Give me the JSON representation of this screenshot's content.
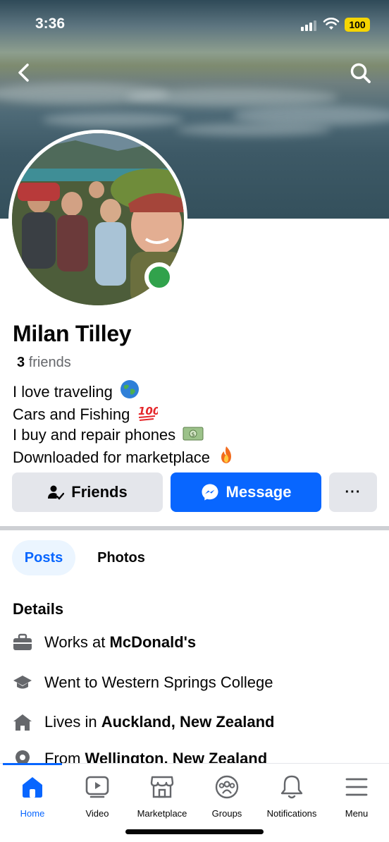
{
  "status_bar": {
    "time": "3:36",
    "battery": "100"
  },
  "profile": {
    "name": "Milan Tilley",
    "friends_count": "3",
    "friends_label": "friends",
    "bio": [
      {
        "text": "I love traveling",
        "emoji": "globe-emoji"
      },
      {
        "text": "Cars and Fishing",
        "emoji": "hundred-points-emoji"
      },
      {
        "text": "I buy and repair phones",
        "emoji": "money-emoji"
      },
      {
        "text": "Downloaded for marketplace",
        "emoji": "fire-emoji"
      }
    ]
  },
  "actions": {
    "friends_label": "Friends",
    "message_label": "Message",
    "more_label": "···"
  },
  "tabs": [
    {
      "label": "Posts",
      "active": true
    },
    {
      "label": "Photos",
      "active": false
    }
  ],
  "details": {
    "title": "Details",
    "work_prefix": "Works at ",
    "work_place": "McDonald's",
    "education": "Went to Western Springs College",
    "lives_prefix": "Lives in ",
    "lives_place": "Auckland, New Zealand",
    "from_prefix": "From ",
    "from_place": "Wellington, New Zealand"
  },
  "nav": [
    {
      "label": "Home",
      "icon": "home-icon",
      "active": true
    },
    {
      "label": "Video",
      "icon": "video-icon",
      "active": false
    },
    {
      "label": "Marketplace",
      "icon": "marketplace-icon",
      "active": false
    },
    {
      "label": "Groups",
      "icon": "groups-icon",
      "active": false
    },
    {
      "label": "Notifications",
      "icon": "bell-icon",
      "active": false
    },
    {
      "label": "Menu",
      "icon": "menu-icon",
      "active": false
    }
  ],
  "colors": {
    "accent": "#0866ff",
    "online": "#31a24c",
    "button_gray": "#e4e6eb"
  }
}
